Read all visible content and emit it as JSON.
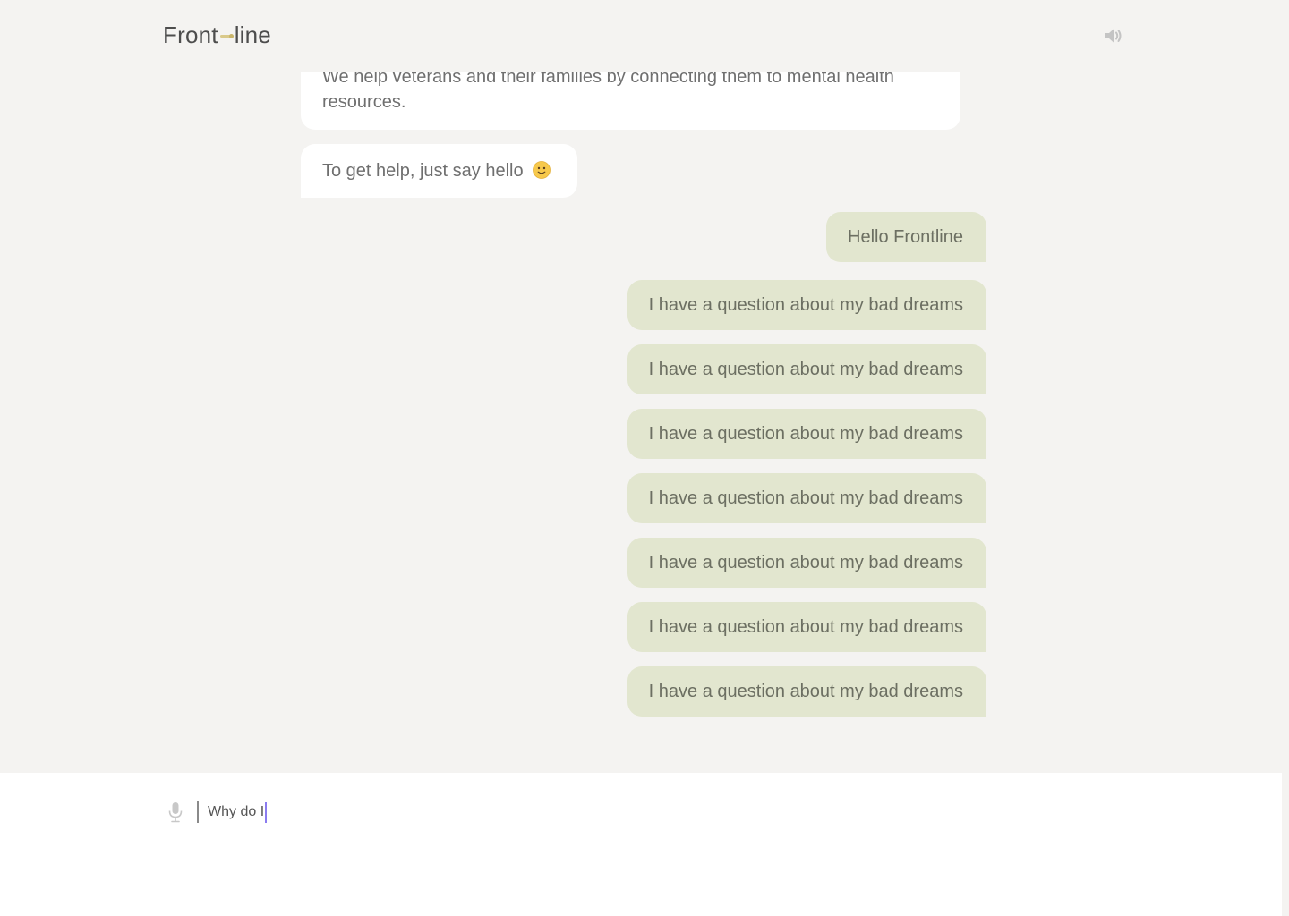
{
  "app": {
    "logo_left": "Front",
    "logo_right": "line"
  },
  "header": {
    "speaker_icon": "speaker-volume-icon"
  },
  "messages": [
    {
      "role": "bot",
      "text": "We help veterans and their families by connecting them to mental health resources."
    },
    {
      "role": "bot",
      "text": "To get help, just say hello",
      "emoji": "slightly-smiling-face-icon"
    },
    {
      "role": "user",
      "text": "Hello Frontline"
    },
    {
      "role": "user",
      "text": "I have a question about my bad dreams"
    },
    {
      "role": "user",
      "text": "I have a question about my bad dreams"
    },
    {
      "role": "user",
      "text": "I have a question about my bad dreams"
    },
    {
      "role": "user",
      "text": "I have a question about my bad dreams"
    },
    {
      "role": "user",
      "text": "I have a question about my bad dreams"
    },
    {
      "role": "user",
      "text": "I have a question about my bad dreams"
    },
    {
      "role": "user",
      "text": "I have a question about my bad dreams"
    }
  ],
  "composer": {
    "mic_icon": "microphone-icon",
    "input_value": "Why do I"
  },
  "colors": {
    "background": "#f4f3f1",
    "bot_bubble": "#ffffff",
    "user_bubble": "#e2e6cf",
    "caret": "#8b7cf0",
    "logo_accent": "#d9c98a"
  }
}
